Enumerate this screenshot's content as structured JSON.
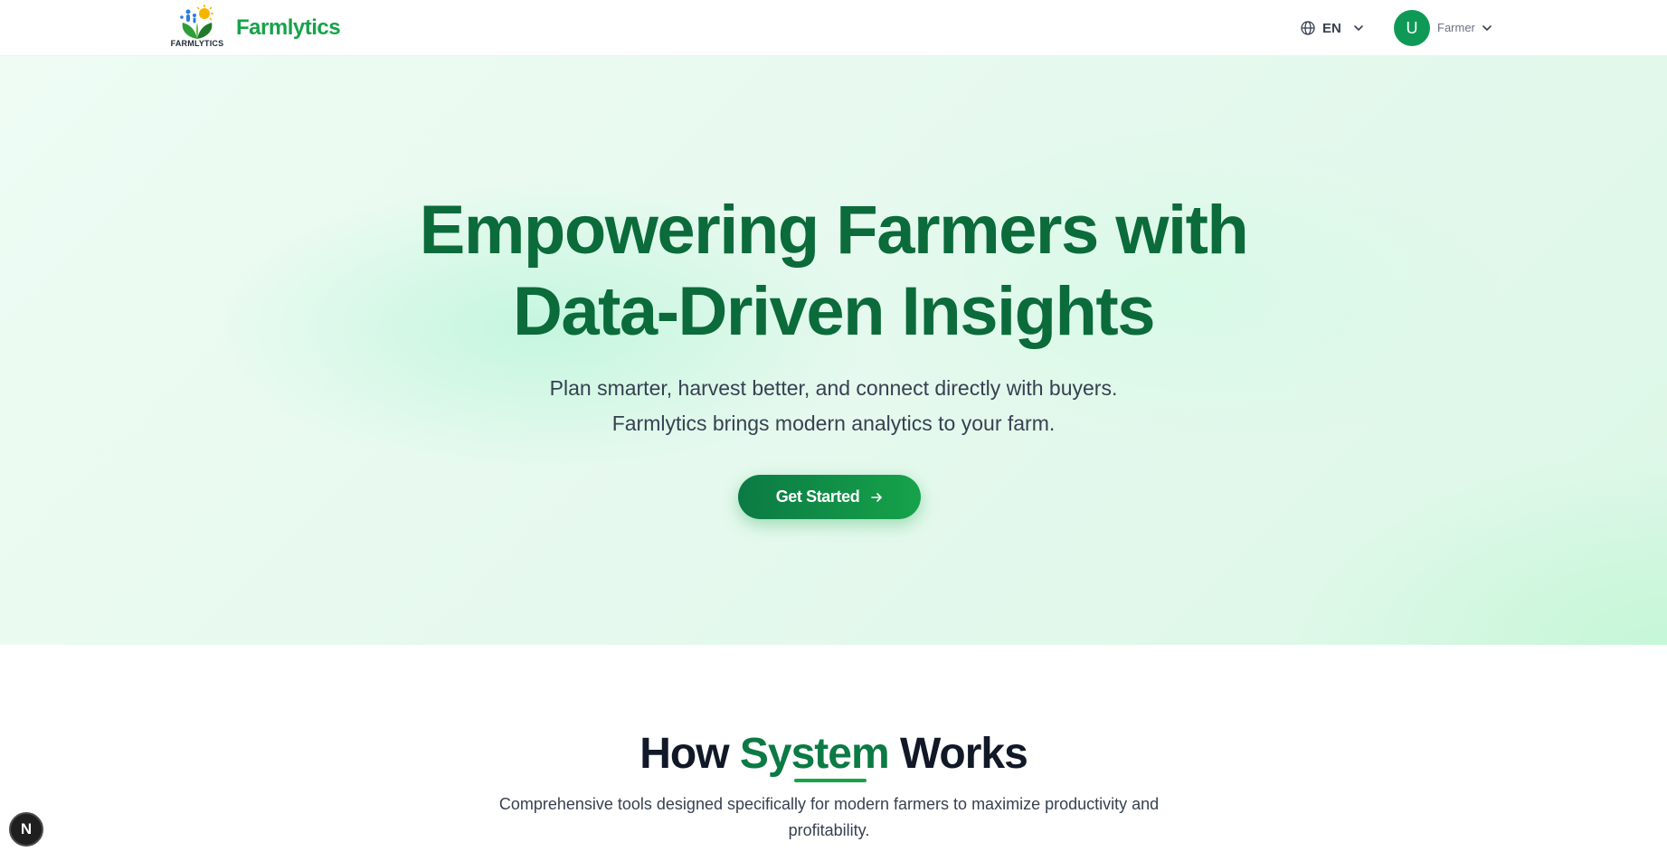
{
  "header": {
    "logo_caption": "FARMLYTICS",
    "brand": "Farmlytics",
    "language": {
      "icon": "globe-icon",
      "label": "EN",
      "chevron": "chevron-down-icon"
    },
    "user": {
      "avatar_initial": "U",
      "role": "Farmer",
      "chevron": "chevron-down-icon"
    }
  },
  "hero": {
    "title_line1": "Empowering Farmers with",
    "title_line2": "Data-Driven Insights",
    "subtitle_line1": "Plan smarter, harvest better, and connect directly with buyers.",
    "subtitle_line2": "Farmlytics brings modern analytics to your farm.",
    "cta_label": "Get Started",
    "cta_icon": "arrow-right-icon"
  },
  "how": {
    "title_before": "How ",
    "title_accent": "System",
    "title_after": " Works",
    "description": "Comprehensive tools designed specifically for modern farmers to maximize productivity and profitability."
  },
  "floating_badge": {
    "label": "N"
  },
  "colors": {
    "brand_green": "#16a34a",
    "dark_green": "#0b6b3a",
    "avatar_green": "#0f9956",
    "hero_bg": "#e6f9ee",
    "text_dark": "#111827",
    "text_body": "#374151"
  }
}
